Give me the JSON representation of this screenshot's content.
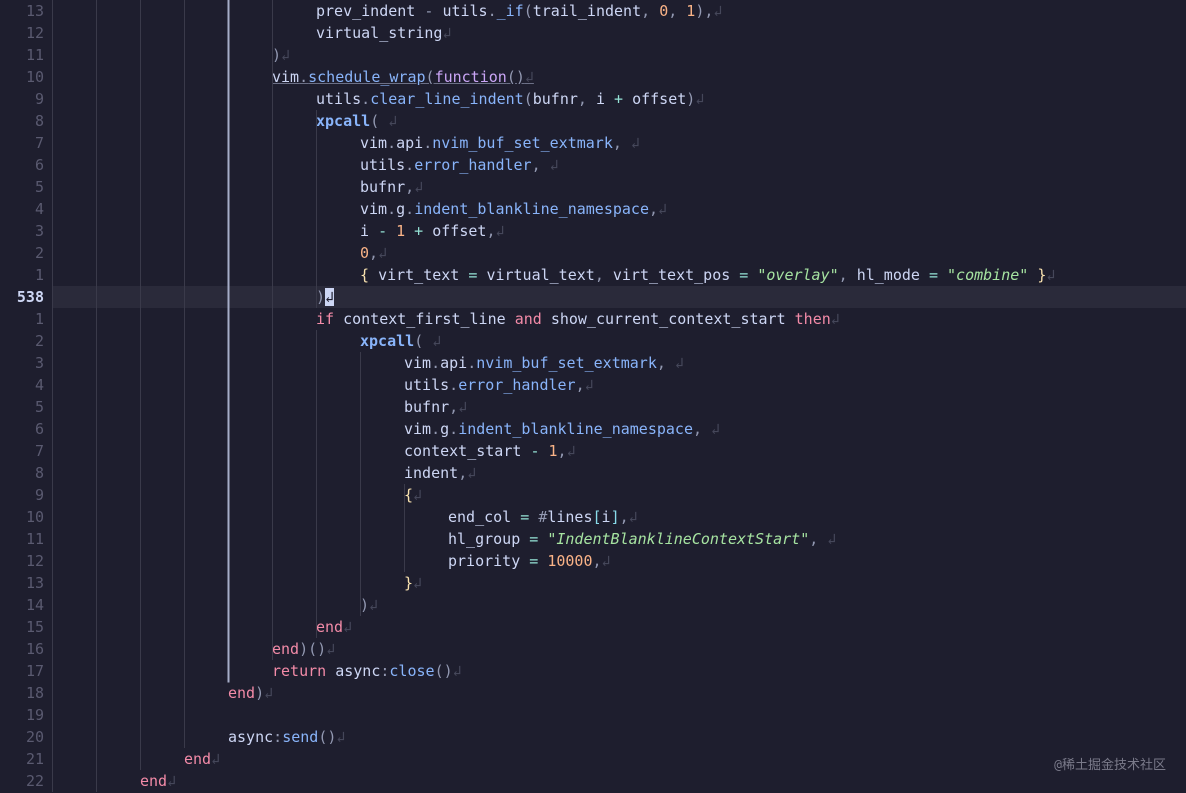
{
  "watermark": "@稀土掘金技术社区",
  "current_line_number": "538",
  "lines": [
    {
      "n": "13",
      "indent": 6,
      "tokens": [
        [
          "id",
          "prev_indent"
        ],
        [
          "pun",
          " - "
        ],
        [
          "id",
          "utils"
        ],
        [
          "pun",
          "."
        ],
        [
          "mth",
          "_if"
        ],
        [
          "pun",
          "("
        ],
        [
          "id",
          "trail_indent"
        ],
        [
          "pun",
          ", "
        ],
        [
          "num",
          "0"
        ],
        [
          "pun",
          ", "
        ],
        [
          "num",
          "1"
        ],
        [
          "pun",
          "),"
        ],
        [
          "ws",
          "↲"
        ]
      ]
    },
    {
      "n": "12",
      "indent": 6,
      "tokens": [
        [
          "id",
          "virtual_string"
        ],
        [
          "ws",
          "↲"
        ]
      ]
    },
    {
      "n": "11",
      "indent": 5,
      "tokens": [
        [
          "pun",
          ")"
        ],
        [
          "ws",
          "↲"
        ]
      ]
    },
    {
      "n": "10",
      "indent": 5,
      "tokens": [
        [
          "id",
          "vim"
        ],
        [
          "pun",
          "."
        ],
        [
          "fn",
          "schedule_wrap"
        ],
        [
          "pun",
          "("
        ],
        [
          "kw",
          "function"
        ],
        [
          "pun",
          "()"
        ],
        [
          "ws",
          "↲"
        ]
      ],
      "underline": true
    },
    {
      "n": "9",
      "indent": 6,
      "tokens": [
        [
          "id",
          "utils"
        ],
        [
          "pun",
          "."
        ],
        [
          "mth",
          "clear_line_indent"
        ],
        [
          "pun",
          "("
        ],
        [
          "id",
          "bufnr"
        ],
        [
          "pun",
          ", "
        ],
        [
          "id",
          "i "
        ],
        [
          "op",
          "+ "
        ],
        [
          "id",
          "offset"
        ],
        [
          "pun",
          ")"
        ],
        [
          "ws",
          "↲"
        ]
      ]
    },
    {
      "n": "8",
      "indent": 6,
      "tokens": [
        [
          "fn",
          "xpcall"
        ],
        [
          "pun",
          "("
        ],
        [
          "ws",
          " ↲"
        ]
      ],
      "bold": true
    },
    {
      "n": "7",
      "indent": 7,
      "tokens": [
        [
          "id",
          "vim"
        ],
        [
          "pun",
          "."
        ],
        [
          "prop",
          "api"
        ],
        [
          "pun",
          "."
        ],
        [
          "mth",
          "nvim_buf_set_extmark"
        ],
        [
          "pun",
          ","
        ],
        [
          "ws",
          " ↲"
        ]
      ]
    },
    {
      "n": "6",
      "indent": 7,
      "tokens": [
        [
          "id",
          "utils"
        ],
        [
          "pun",
          "."
        ],
        [
          "mth",
          "error_handler"
        ],
        [
          "pun",
          ","
        ],
        [
          "ws",
          " ↲"
        ]
      ]
    },
    {
      "n": "5",
      "indent": 7,
      "tokens": [
        [
          "id",
          "bufnr"
        ],
        [
          "pun",
          ","
        ],
        [
          "ws",
          "↲"
        ]
      ]
    },
    {
      "n": "4",
      "indent": 7,
      "tokens": [
        [
          "id",
          "vim"
        ],
        [
          "pun",
          "."
        ],
        [
          "prop",
          "g"
        ],
        [
          "pun",
          "."
        ],
        [
          "mth",
          "indent_blankline_namespace"
        ],
        [
          "pun",
          ","
        ],
        [
          "ws",
          "↲"
        ]
      ]
    },
    {
      "n": "3",
      "indent": 7,
      "tokens": [
        [
          "id",
          "i "
        ],
        [
          "op",
          "- "
        ],
        [
          "num",
          "1"
        ],
        [
          "op",
          " + "
        ],
        [
          "id",
          "offset"
        ],
        [
          "pun",
          ","
        ],
        [
          "ws",
          "↲"
        ]
      ]
    },
    {
      "n": "2",
      "indent": 7,
      "tokens": [
        [
          "num",
          "0"
        ],
        [
          "pun",
          ","
        ],
        [
          "ws",
          "↲"
        ]
      ]
    },
    {
      "n": "1",
      "indent": 7,
      "tokens": [
        [
          "br",
          "{ "
        ],
        [
          "id",
          "virt_text"
        ],
        [
          "op",
          " = "
        ],
        [
          "id",
          "virtual_text"
        ],
        [
          "pun",
          ", "
        ],
        [
          "id",
          "virt_text_pos"
        ],
        [
          "op",
          " = "
        ],
        [
          "str",
          "\"overlay\""
        ],
        [
          "pun",
          ", "
        ],
        [
          "id",
          "hl_mode"
        ],
        [
          "op",
          " = "
        ],
        [
          "str",
          "\"combine\""
        ],
        [
          "br",
          " }"
        ],
        [
          "ws",
          "↲"
        ]
      ]
    },
    {
      "n": "538",
      "indent": 6,
      "hl": true,
      "tokens": [
        [
          "pun",
          ")"
        ],
        [
          "cursor",
          "↲"
        ]
      ]
    },
    {
      "n": "1",
      "indent": 6,
      "tokens": [
        [
          "kw2",
          "if "
        ],
        [
          "id",
          "context_first_line "
        ],
        [
          "kw2",
          "and "
        ],
        [
          "id",
          "show_current_context_start "
        ],
        [
          "kw2",
          "then"
        ],
        [
          "ws",
          "↲"
        ]
      ]
    },
    {
      "n": "2",
      "indent": 7,
      "tokens": [
        [
          "fn",
          "xpcall"
        ],
        [
          "pun",
          "("
        ],
        [
          "ws",
          " ↲"
        ]
      ],
      "bold": true
    },
    {
      "n": "3",
      "indent": 8,
      "tokens": [
        [
          "id",
          "vim"
        ],
        [
          "pun",
          "."
        ],
        [
          "prop",
          "api"
        ],
        [
          "pun",
          "."
        ],
        [
          "mth",
          "nvim_buf_set_extmark"
        ],
        [
          "pun",
          ","
        ],
        [
          "ws",
          " ↲"
        ]
      ]
    },
    {
      "n": "4",
      "indent": 8,
      "tokens": [
        [
          "id",
          "utils"
        ],
        [
          "pun",
          "."
        ],
        [
          "mth",
          "error_handler"
        ],
        [
          "pun",
          ","
        ],
        [
          "ws",
          "↲"
        ]
      ]
    },
    {
      "n": "5",
      "indent": 8,
      "tokens": [
        [
          "id",
          "bufnr"
        ],
        [
          "pun",
          ","
        ],
        [
          "ws",
          "↲"
        ]
      ]
    },
    {
      "n": "6",
      "indent": 8,
      "tokens": [
        [
          "id",
          "vim"
        ],
        [
          "pun",
          "."
        ],
        [
          "prop",
          "g"
        ],
        [
          "pun",
          "."
        ],
        [
          "mth",
          "indent_blankline_namespace"
        ],
        [
          "pun",
          ","
        ],
        [
          "ws",
          " ↲"
        ]
      ]
    },
    {
      "n": "7",
      "indent": 8,
      "tokens": [
        [
          "id",
          "context_start "
        ],
        [
          "op",
          "- "
        ],
        [
          "num",
          "1"
        ],
        [
          "pun",
          ","
        ],
        [
          "ws",
          "↲"
        ]
      ]
    },
    {
      "n": "8",
      "indent": 8,
      "tokens": [
        [
          "id",
          "indent"
        ],
        [
          "pun",
          ","
        ],
        [
          "ws",
          "↲"
        ]
      ]
    },
    {
      "n": "9",
      "indent": 8,
      "tokens": [
        [
          "br",
          "{"
        ],
        [
          "ws",
          "↲"
        ]
      ]
    },
    {
      "n": "10",
      "indent": 9,
      "tokens": [
        [
          "id",
          "end_col"
        ],
        [
          "op",
          " = "
        ],
        [
          "pun",
          "#"
        ],
        [
          "id",
          "lines"
        ],
        [
          "bk",
          "["
        ],
        [
          "id",
          "i"
        ],
        [
          "bk",
          "]"
        ],
        [
          "pun",
          ","
        ],
        [
          "ws",
          "↲"
        ]
      ]
    },
    {
      "n": "11",
      "indent": 9,
      "tokens": [
        [
          "id",
          "hl_group"
        ],
        [
          "op",
          " = "
        ],
        [
          "str",
          "\"IndentBlanklineContextStart\""
        ],
        [
          "pun",
          ","
        ],
        [
          "ws",
          " ↲"
        ]
      ]
    },
    {
      "n": "12",
      "indent": 9,
      "tokens": [
        [
          "id",
          "priority"
        ],
        [
          "op",
          " = "
        ],
        [
          "num",
          "10000"
        ],
        [
          "pun",
          ","
        ],
        [
          "ws",
          "↲"
        ]
      ]
    },
    {
      "n": "13",
      "indent": 8,
      "tokens": [
        [
          "br",
          "}"
        ],
        [
          "ws",
          "↲"
        ]
      ]
    },
    {
      "n": "14",
      "indent": 7,
      "tokens": [
        [
          "pun",
          ")"
        ],
        [
          "ws",
          "↲"
        ]
      ]
    },
    {
      "n": "15",
      "indent": 6,
      "tokens": [
        [
          "kw2",
          "end"
        ],
        [
          "ws",
          "↲"
        ]
      ]
    },
    {
      "n": "16",
      "indent": 5,
      "tokens": [
        [
          "kw2",
          "end"
        ],
        [
          "pun",
          ")()"
        ],
        [
          "ws",
          "↲"
        ]
      ]
    },
    {
      "n": "17",
      "indent": 5,
      "tokens": [
        [
          "kw2",
          "return "
        ],
        [
          "id",
          "async"
        ],
        [
          "pun",
          ":"
        ],
        [
          "mth",
          "close"
        ],
        [
          "pun",
          "()"
        ],
        [
          "ws",
          "↲"
        ]
      ]
    },
    {
      "n": "18",
      "indent": 4,
      "tokens": [
        [
          "kw2",
          "end"
        ],
        [
          "pun",
          ")"
        ],
        [
          "ws",
          "↲"
        ]
      ]
    },
    {
      "n": "19",
      "indent": 0,
      "tokens": [
        [
          "ws",
          ""
        ]
      ]
    },
    {
      "n": "20",
      "indent": 4,
      "tokens": [
        [
          "id",
          "async"
        ],
        [
          "pun",
          ":"
        ],
        [
          "mth",
          "send"
        ],
        [
          "pun",
          "()"
        ],
        [
          "ws",
          "↲"
        ]
      ]
    },
    {
      "n": "21",
      "indent": 3,
      "tokens": [
        [
          "kw2",
          "end"
        ],
        [
          "ws",
          "↲"
        ]
      ]
    },
    {
      "n": "22",
      "indent": 2,
      "tokens": [
        [
          "kw2",
          "end"
        ],
        [
          "ws",
          "↲"
        ]
      ]
    }
  ],
  "tokenClasses": {
    "fn": "c-fn",
    "mth": "c-fn",
    "id": "c-id",
    "prop": "c-prop",
    "kw": "c-kw",
    "kw2": "c-kw2",
    "num": "c-num",
    "str": "c-str",
    "op": "c-op",
    "pun": "c-pun",
    "par": "c-par",
    "br": "c-br",
    "bk": "c-bk",
    "ws": "ws",
    "cursor": "cursor"
  },
  "indentWidth": 44,
  "charWidth": 11,
  "guides": [
    {
      "col": 0,
      "from": 0,
      "to": 35,
      "ctx": false
    },
    {
      "col": 1,
      "from": 0,
      "to": 35,
      "ctx": false
    },
    {
      "col": 2,
      "from": 0,
      "to": 34,
      "ctx": false
    },
    {
      "col": 3,
      "from": 0,
      "to": 33,
      "ctx": false
    },
    {
      "col": 4,
      "from": 0,
      "to": 30,
      "ctx": true
    },
    {
      "col": 5,
      "from": 0,
      "to": 29,
      "ctx": false
    },
    {
      "col": 6,
      "from": 5,
      "to": 13,
      "ctx": false
    },
    {
      "col": 6,
      "from": 15,
      "to": 28,
      "ctx": false
    },
    {
      "col": 7,
      "from": 16,
      "to": 27,
      "ctx": false
    },
    {
      "col": 8,
      "from": 22,
      "to": 25,
      "ctx": false
    }
  ]
}
